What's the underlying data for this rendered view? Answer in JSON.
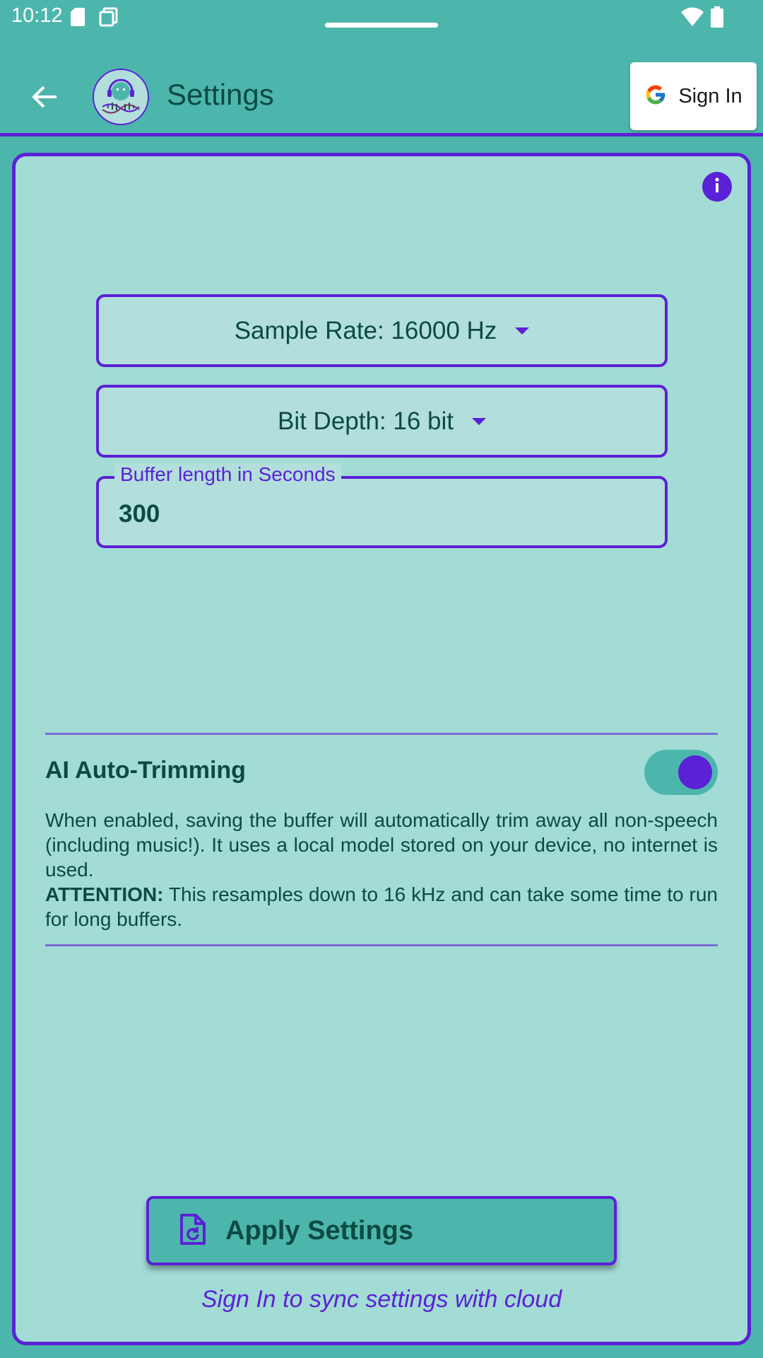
{
  "status_bar": {
    "time": "10:12",
    "icons": [
      "sd-card-icon",
      "screenshot-icon",
      "wifi-icon",
      "battery-icon"
    ]
  },
  "app_bar": {
    "title": "Settings",
    "back_icon": "arrow-back-icon",
    "logo_icon": "headphones-robot-logo",
    "signin_label": "Sign In",
    "signin_icon": "google-g-icon"
  },
  "settings": {
    "info_icon": "info-icon",
    "sample_rate_label": "Sample Rate: 16000 Hz",
    "bit_depth_label": "Bit Depth: 16 bit",
    "buffer_label": "Buffer length in Seconds",
    "buffer_value": "300"
  },
  "ai_trimming": {
    "title": "AI Auto-Trimming",
    "enabled": true,
    "description": "When enabled, saving the buffer will automatically trim away all non-speech (including music!). It uses a local model stored on your device, no internet is used.",
    "attention_label": "ATTENTION:",
    "attention_text": " This resamples down to 16 kHz and can take some time to run for long buffers."
  },
  "actions": {
    "apply_label": "Apply Settings",
    "apply_icon": "file-restore-icon",
    "sync_note": "Sign In to sync settings with cloud"
  },
  "colors": {
    "accent": "#5b21d6",
    "app_bar": "#4db6ac",
    "card": "#a2dcd5",
    "field": "#b2dfdb",
    "text": "#0c4a44"
  }
}
